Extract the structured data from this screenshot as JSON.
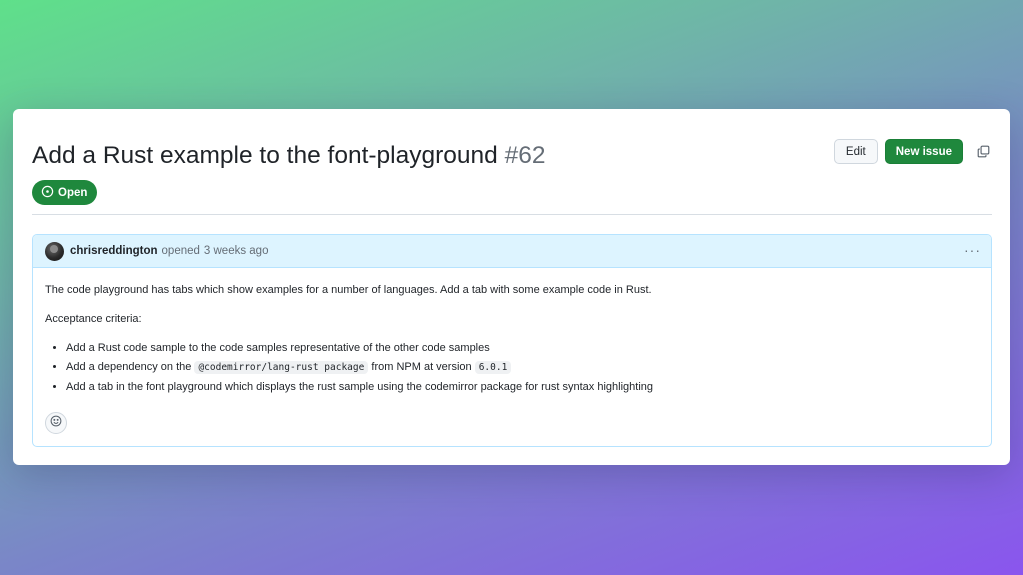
{
  "issue": {
    "title": "Add a Rust example to the font-playground",
    "number": "#62",
    "state": "Open"
  },
  "actions": {
    "edit_label": "Edit",
    "new_issue_label": "New issue",
    "copy_icon": "copy-icon"
  },
  "comment": {
    "author": "chrisreddington",
    "action": "opened",
    "time": "3 weeks ago",
    "menu_icon": "kebab-horizontal-icon",
    "reaction_icon": "smiley-icon",
    "body": {
      "intro": "The code playground has tabs which show examples for a number of languages. Add a tab with some example code in Rust.",
      "criteria_heading": "Acceptance criteria:",
      "items": [
        {
          "text": "Add a Rust code sample to the code samples representative of the other code samples"
        },
        {
          "pre": "Add a dependency on the",
          "code1": "@codemirror/lang-rust package",
          "mid": "from NPM at version",
          "code2": "6.0.1"
        },
        {
          "text": "Add a tab in the font playground which displays the rust sample using the codemirror package for rust syntax highlighting"
        }
      ]
    }
  },
  "colors": {
    "primary_green": "#1f883d",
    "comment_header_bg": "#ddf4ff",
    "comment_border": "#b6e3ff"
  }
}
